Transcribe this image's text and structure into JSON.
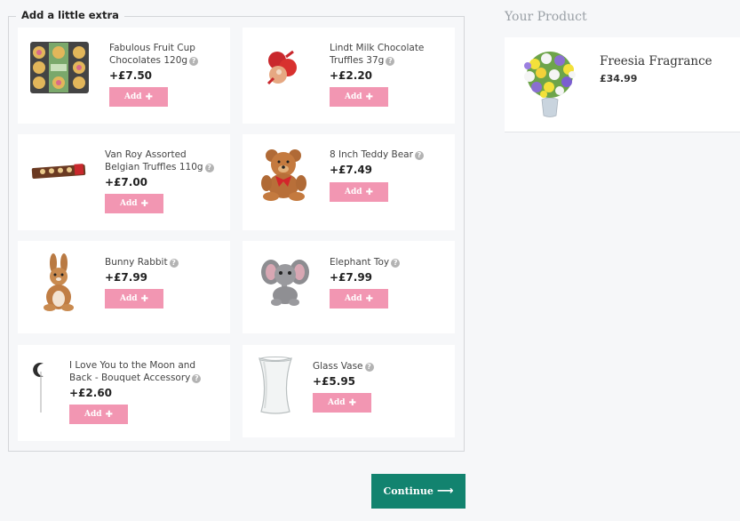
{
  "extras": {
    "legend": "Add a little extra",
    "add_label": "Add",
    "items": [
      {
        "name": "Fabulous Fruit Cup Chocolates 120g",
        "price": "+£7.50"
      },
      {
        "name": "Lindt Milk Chocolate Truffles 37g",
        "price": "+£2.20"
      },
      {
        "name": "Van Roy Assorted Belgian Truffles 110g",
        "price": "+£7.00"
      },
      {
        "name": "8 Inch Teddy Bear",
        "price": "+£7.49"
      },
      {
        "name": "Bunny Rabbit",
        "price": "+£7.99"
      },
      {
        "name": "Elephant Toy",
        "price": "+£7.99"
      },
      {
        "name": "I Love You to the Moon and Back - Bouquet Accessory",
        "price": "+£2.60"
      },
      {
        "name": "Glass Vase",
        "price": "+£5.95"
      }
    ]
  },
  "your_product": {
    "title": "Your Product",
    "name": "Freesia Fragrance",
    "price": "£34.99"
  },
  "continue_label": "Continue",
  "colors": {
    "add_button": "#f296b2",
    "continue_button": "#12836f",
    "background": "#f6f7f9"
  }
}
